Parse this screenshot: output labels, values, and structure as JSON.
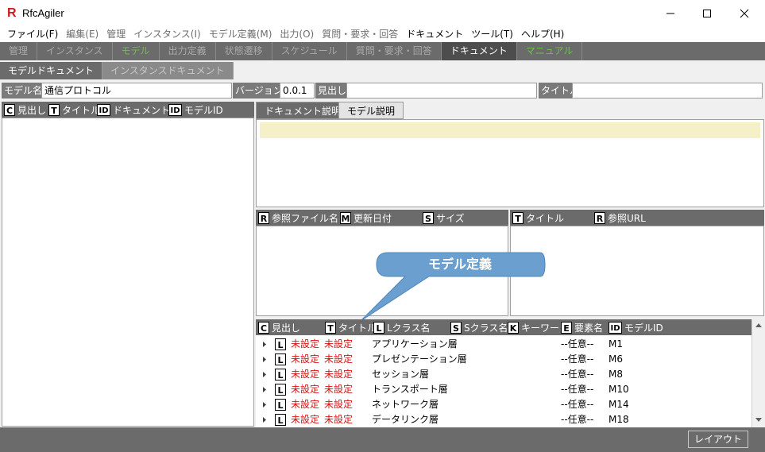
{
  "window": {
    "title": "RfcAgiler",
    "logo": "R"
  },
  "menu": [
    {
      "label": "ファイル(F)",
      "dim": false
    },
    {
      "label": "編集(E)",
      "dim": true
    },
    {
      "label": "管理",
      "dim": true
    },
    {
      "label": "インスタンス(I)",
      "dim": true
    },
    {
      "label": "モデル定義(M)",
      "dim": true
    },
    {
      "label": "出力(O)",
      "dim": true
    },
    {
      "label": "質問・要求・回答",
      "dim": true
    },
    {
      "label": "ドキュメント",
      "dim": false
    },
    {
      "label": "ツール(T)",
      "dim": false
    },
    {
      "label": "ヘルプ(H)",
      "dim": false
    }
  ],
  "main_tabs": [
    {
      "label": "管理",
      "state": "normal"
    },
    {
      "label": "インスタンス",
      "state": "normal"
    },
    {
      "label": "モデル",
      "state": "green"
    },
    {
      "label": "出力定義",
      "state": "normal"
    },
    {
      "label": "状態遷移",
      "state": "normal"
    },
    {
      "label": "スケジュール",
      "state": "normal"
    },
    {
      "label": "質問・要求・回答",
      "state": "normal"
    },
    {
      "label": "ドキュメント",
      "state": "active"
    },
    {
      "label": "マニュアル",
      "state": "green"
    }
  ],
  "sub_tabs": [
    {
      "label": "モデルドキュメント",
      "state": "active"
    },
    {
      "label": "インスタンスドキュメント",
      "state": "inactive"
    }
  ],
  "info": {
    "model_name_label": "モデル名",
    "model_name_value": "通信プロトコル",
    "version_label": "バージョン",
    "version_value": "0.0.1",
    "heading_label": "見出し",
    "heading_value": "",
    "title_label": "タイトル",
    "title_value": ""
  },
  "left_header": [
    {
      "badge": "C",
      "label": "見出し"
    },
    {
      "badge": "T",
      "label": "タイトル"
    },
    {
      "badge": "ID",
      "label": "ドキュメントID"
    },
    {
      "badge": "ID",
      "label": "モデルID"
    }
  ],
  "doc_tabs": [
    {
      "label": "ドキュメント説明",
      "active": false
    },
    {
      "label": "モデル説明",
      "active": true
    }
  ],
  "ref_file_header": [
    {
      "badge": "R",
      "label": "参照ファイル名"
    },
    {
      "badge": "M",
      "label": "更新日付"
    },
    {
      "badge": "S",
      "label": "サイズ"
    }
  ],
  "ref_url_header": [
    {
      "badge": "T",
      "label": "タイトル"
    },
    {
      "badge": "R",
      "label": "参照URL"
    }
  ],
  "callout": {
    "text": "モデル定義",
    "color": "#6a9fd0"
  },
  "tree_header": [
    {
      "badge": "C",
      "label": "見出し"
    },
    {
      "badge": "T",
      "label": "タイトル"
    },
    {
      "badge": "L",
      "label": "Lクラス名"
    },
    {
      "badge": "S",
      "label": "Sクラス名"
    },
    {
      "badge": "K",
      "label": "キーワード"
    },
    {
      "badge": "E",
      "label": "要素名"
    },
    {
      "badge": "ID",
      "label": "モデルID"
    }
  ],
  "tree_rows": [
    {
      "badge": "L",
      "heading": "未設定",
      "title": "未設定",
      "lclass": "アプリケーション層",
      "element": "--任意--",
      "model_id": "M1"
    },
    {
      "badge": "L",
      "heading": "未設定",
      "title": "未設定",
      "lclass": "プレゼンテーション層",
      "element": "--任意--",
      "model_id": "M6"
    },
    {
      "badge": "L",
      "heading": "未設定",
      "title": "未設定",
      "lclass": "セッション層",
      "element": "--任意--",
      "model_id": "M8"
    },
    {
      "badge": "L",
      "heading": "未設定",
      "title": "未設定",
      "lclass": "トランスポート層",
      "element": "--任意--",
      "model_id": "M10"
    },
    {
      "badge": "L",
      "heading": "未設定",
      "title": "未設定",
      "lclass": "ネットワーク層",
      "element": "--任意--",
      "model_id": "M14"
    },
    {
      "badge": "L",
      "heading": "未設定",
      "title": "未設定",
      "lclass": "データリンク層",
      "element": "--任意--",
      "model_id": "M18"
    }
  ],
  "status": {
    "layout_button": "レイアウト"
  },
  "colors": {
    "header": "#6b6b6b",
    "accent_red": "#dd1111",
    "green_tab": "#6ec14b",
    "description_bg": "#f5f0c8"
  }
}
